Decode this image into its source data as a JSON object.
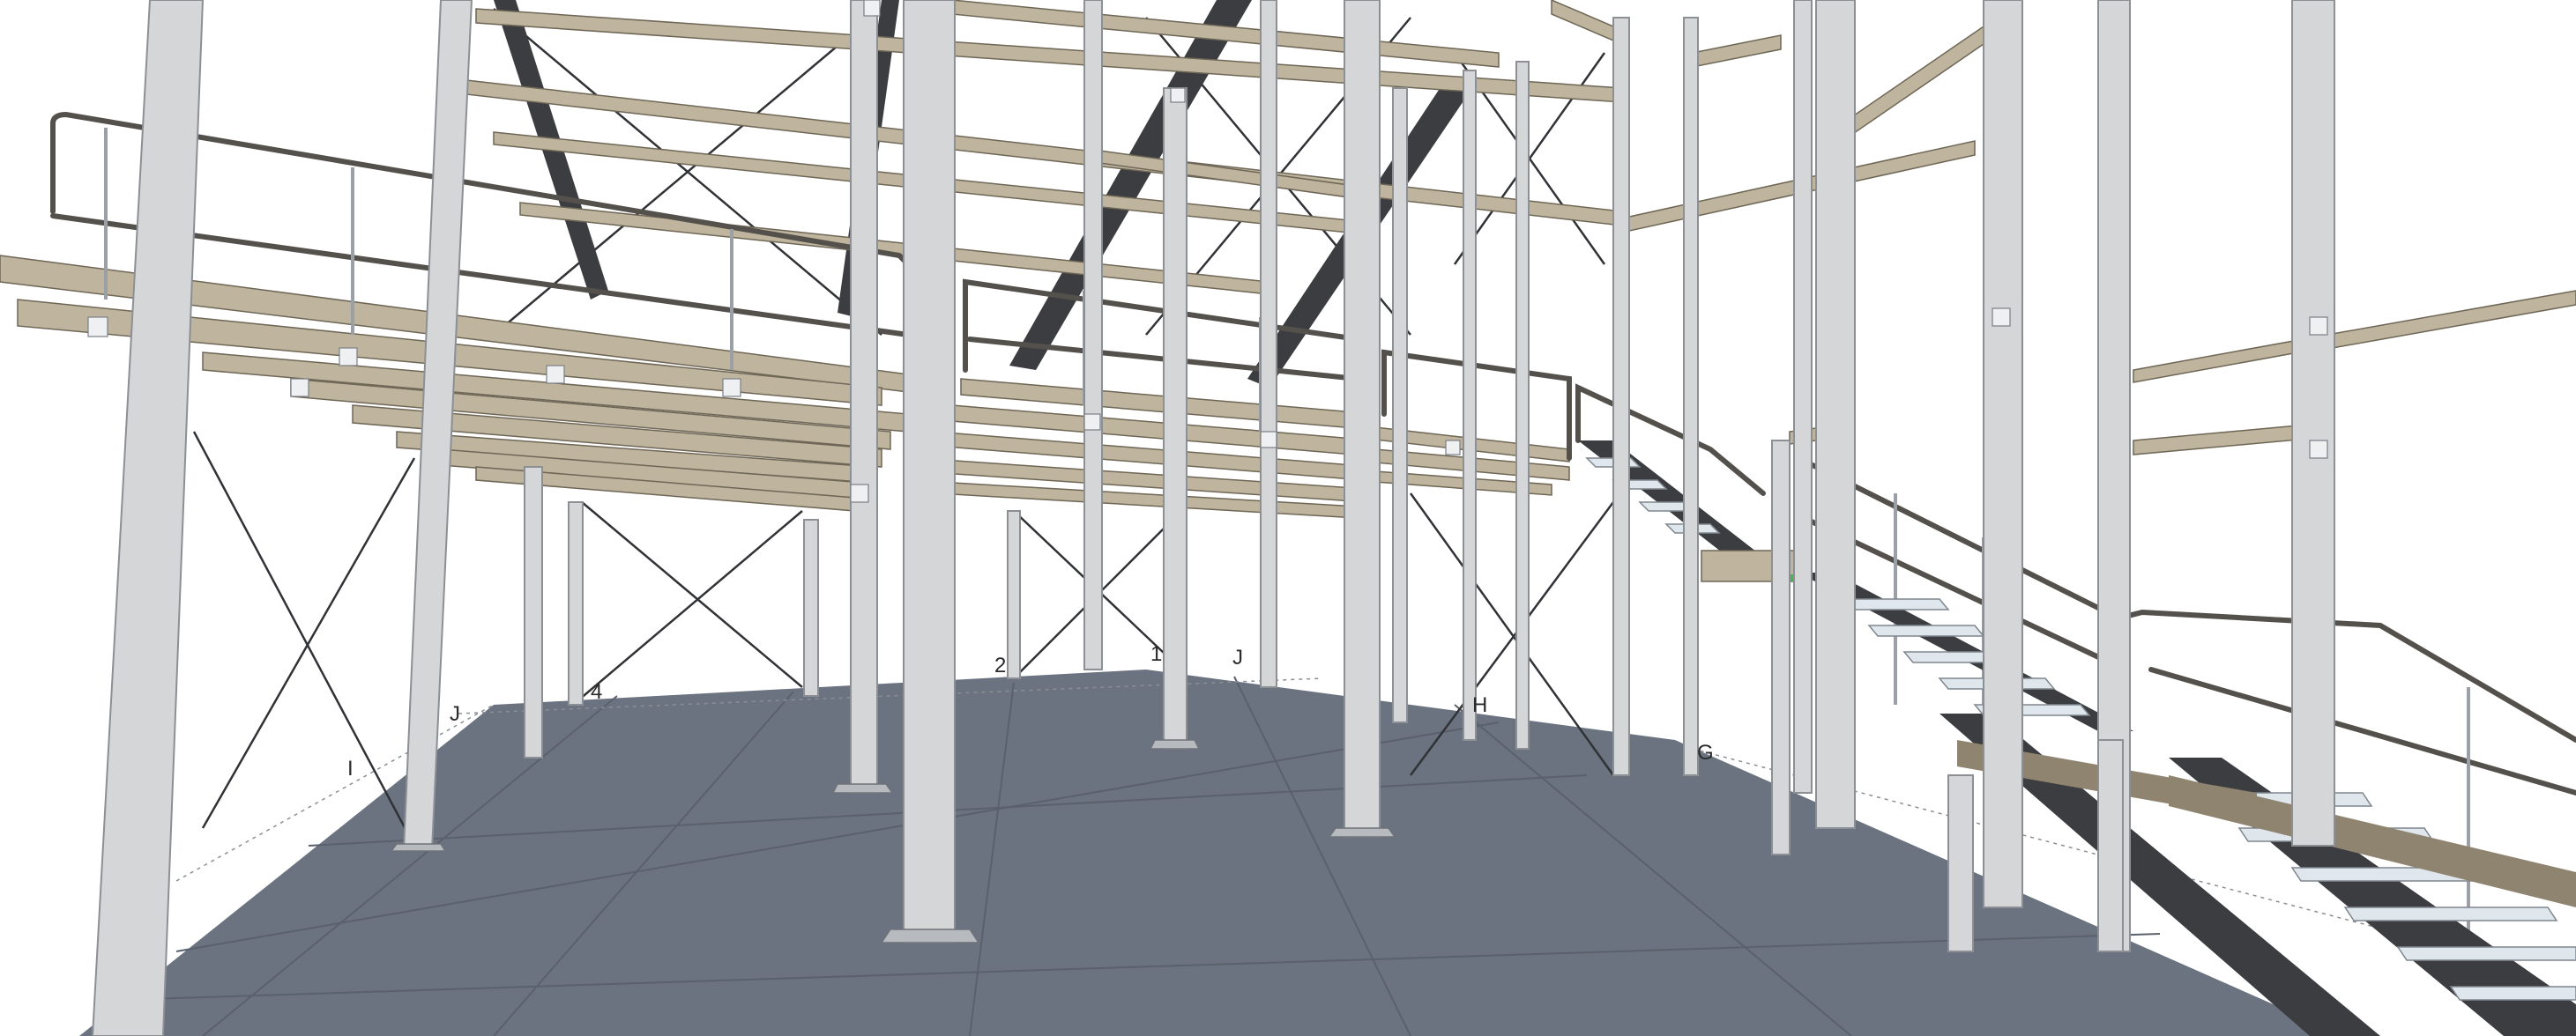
{
  "scene": {
    "background": "#ffffff",
    "floor_color": "#6b7380",
    "floor_line_color": "#5a616c",
    "column_color": "#d4d6d8",
    "column_edge_color": "#8c9095",
    "beam_color": "#bfb49d",
    "beam_edge_color": "#6e6656",
    "dark_member_color": "#3c3d41",
    "rail_color": "#54514c",
    "stair_tread_color": "#dfe6ec",
    "bracing_color": "#303236"
  },
  "grid_labels": [
    "J",
    "I",
    "4",
    "2",
    "1",
    "J",
    "H",
    "G"
  ]
}
